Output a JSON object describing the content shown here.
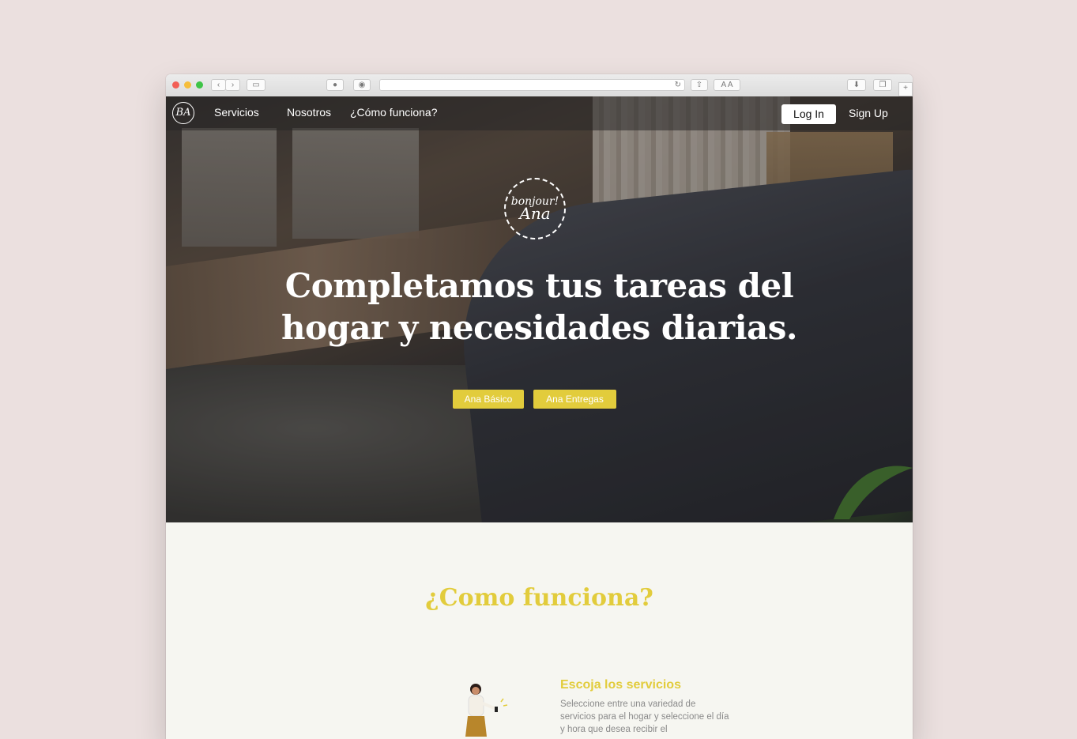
{
  "nav": {
    "logo_text": "BA",
    "links": [
      "Servicios",
      "Nosotros",
      "¿Cómo funciona?"
    ],
    "login": "Log In",
    "signup": "Sign Up"
  },
  "hero": {
    "badge_line1": "bonjour!",
    "badge_line2": "Ana",
    "headline_line1": "Completamos tus tareas del",
    "headline_line2": "hogar y necesidades diarias.",
    "cta_primary": "Ana Básico",
    "cta_secondary": "Ana Entregas"
  },
  "how": {
    "title": "¿Como funciona?",
    "step_title": "Escoja los servicios",
    "step_text": "Seleccione entre una variedad de servicios para el hogar y seleccione el día y hora que desea recibir el"
  },
  "colors": {
    "accent": "#e2cc3c",
    "background": "#ebe0df",
    "page": "#f6f6f1"
  },
  "icons": [
    "close-dot",
    "minimize-dot",
    "zoom-dot",
    "back-icon",
    "forward-icon",
    "sidebar-icon",
    "pinterest-icon",
    "shield-icon",
    "reload-icon",
    "share-icon",
    "text-size-icon",
    "download-icon",
    "tabs-icon",
    "new-tab-icon"
  ]
}
